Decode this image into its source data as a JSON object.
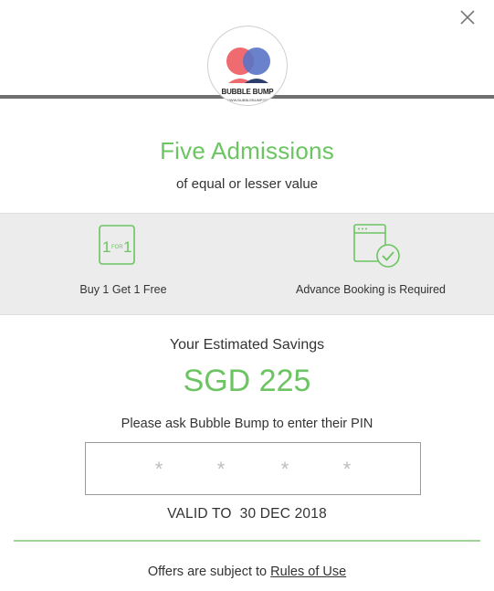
{
  "logo": {
    "brand": "BUBBLE BUMP",
    "url": "WWW.BUBBLEBUMP.SG",
    "colors": {
      "red": "#ef6b6f",
      "blue": "#5a73c5",
      "dark": "#2c3e6b"
    }
  },
  "close": {
    "icon": "close-icon"
  },
  "offer": {
    "title": "Five Admissions",
    "subtitle": "of equal or lesser value"
  },
  "features": [
    {
      "icon": "one-for-one-icon",
      "icon_text_left": "1",
      "icon_text_mid": "FOR",
      "icon_text_right": "1",
      "label": "Buy 1 Get 1 Free"
    },
    {
      "icon": "calendar-check-icon",
      "label": "Advance Booking is Required"
    }
  ],
  "savings": {
    "label": "Your Estimated Savings",
    "value": "SGD 225"
  },
  "pin": {
    "prompt": "Please ask Bubble Bump to enter their PIN",
    "mask": [
      "*",
      "*",
      "*",
      "*"
    ]
  },
  "validity": "VALID TO  30 DEC 2018",
  "footer": {
    "text": "Offers are subject to",
    "link": "Rules of Use"
  },
  "colors": {
    "accent": "#6cc462",
    "rule": "#9ed596",
    "panel": "#ececec"
  }
}
